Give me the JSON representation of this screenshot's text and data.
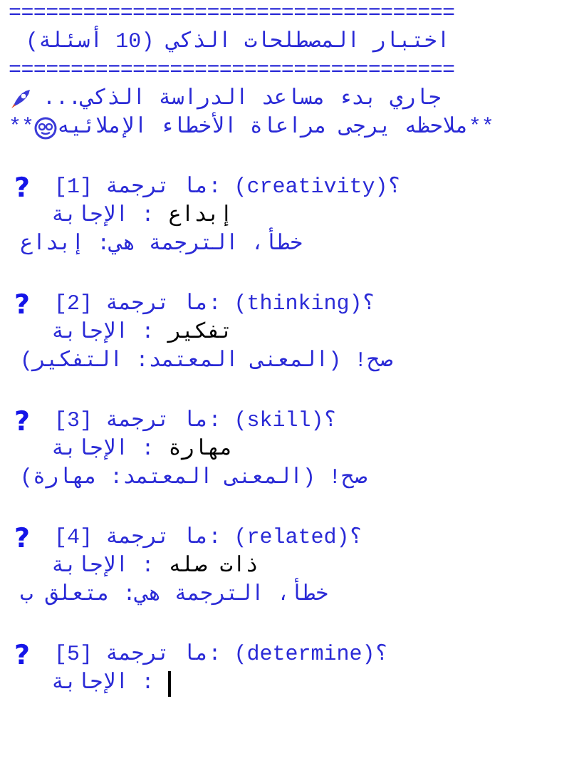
{
  "header": {
    "rule_top": "====================================",
    "title": "اختبار المصطلحات الذكي (10 أسئلة)",
    "rule_bottom": "====================================",
    "status": "جاري بدء مساعد الدراسة الذكي...",
    "note_prefix": "**",
    "note": "**ملاحظه يرجى مراعاة الأخطاء الإملائيه"
  },
  "questions": [
    {
      "mark": "?",
      "prompt": "[1] ما ترجمة: (creativity)؟",
      "answer_label": "الإجابة :",
      "answer": "إبداع",
      "feedback": "خطأ، الترجمة هي: إبداع",
      "cursor": false
    },
    {
      "mark": "?",
      "prompt": "[2] ما ترجمة: (thinking)؟",
      "answer_label": "الإجابة :",
      "answer": "تفكير",
      "feedback": "صح! (المعنى المعتمد: التفكير)",
      "cursor": false
    },
    {
      "mark": "?",
      "prompt": "[3] ما ترجمة: (skill)؟",
      "answer_label": "الإجابة :",
      "answer": "مهارة",
      "feedback": "صح! (المعنى المعتمد: مهارة)",
      "cursor": false
    },
    {
      "mark": "?",
      "prompt": "[4] ما ترجمة: (related)؟",
      "answer_label": "الإجابة :",
      "answer": "ذات صله",
      "feedback": "خطأ، الترجمة هي: متعلق ب",
      "cursor": false
    },
    {
      "mark": "?",
      "prompt": "[5] ما ترجمة: (determine)؟",
      "answer_label": "الإجابة :",
      "cursor": true
    }
  ]
}
